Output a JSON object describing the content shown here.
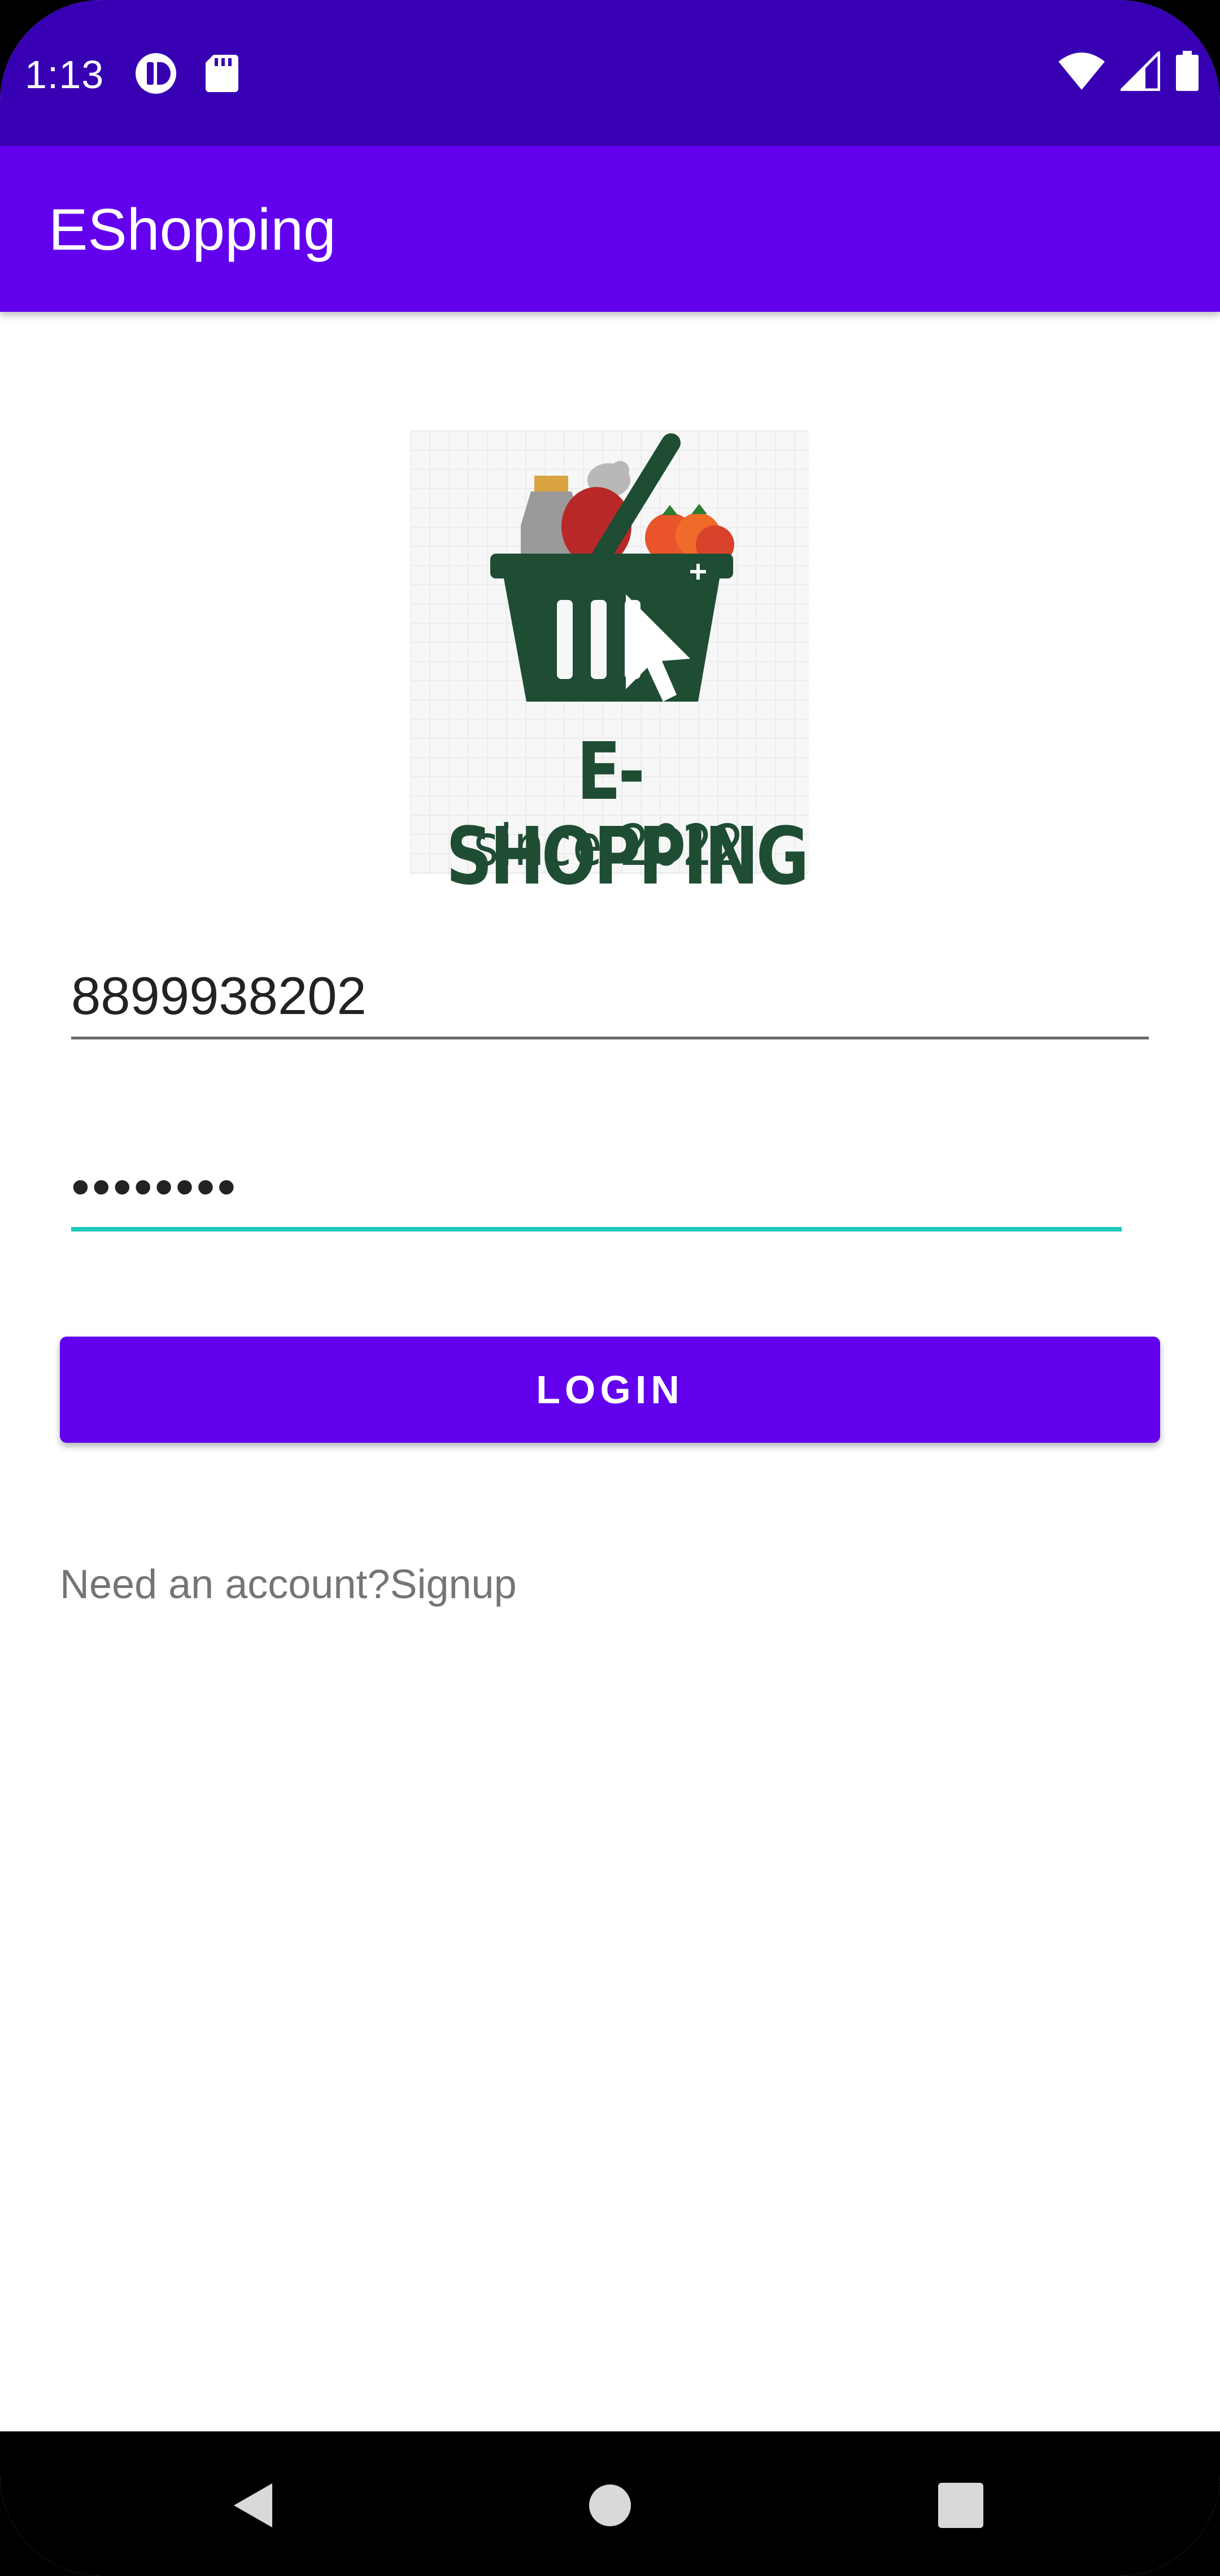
{
  "status_bar": {
    "time": "1:13",
    "left_icons": [
      "notification-app-icon",
      "sd-card-icon"
    ],
    "right_icons": [
      "wifi-icon",
      "cell-signal-icon",
      "battery-icon"
    ],
    "background_color": "#3700B3"
  },
  "app_bar": {
    "title": "EShopping",
    "background_color": "#6200EE"
  },
  "logo": {
    "brand_title": "E-SHOPPING",
    "brand_subtitle": "since 2022",
    "brand_color": "#1E4D33"
  },
  "form": {
    "phone_value": "8899938202",
    "password_value": "••••••••",
    "focus_color": "#1BC9BB",
    "login_label": "LOGIN",
    "signup_text": "Need an account?Signup"
  },
  "nav_bar": {
    "icons": [
      "back-icon",
      "home-icon",
      "recents-icon"
    ]
  }
}
